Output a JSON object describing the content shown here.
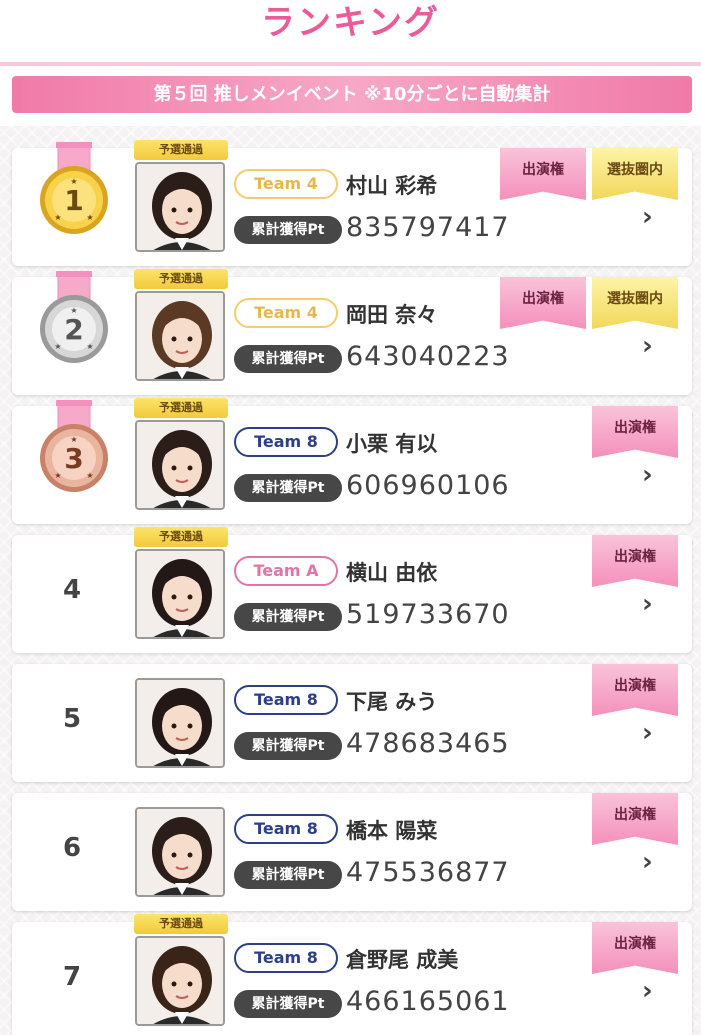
{
  "header": {
    "title": "ランキング"
  },
  "banner": {
    "text": "第５回 推しメンイベント ※10分ごとに自動集計"
  },
  "pt_label": "累計獲得Pt",
  "qual_label": "予選通過",
  "colors": {
    "accent_pink": "#ec5a97",
    "team8_navy": "#2e3f8a",
    "team4_gold": "#e6b84c",
    "teamA_pink": "#e374a8"
  },
  "rankings": [
    {
      "rank": "1",
      "medal": "gold",
      "qualified": true,
      "team": "Team 4",
      "team_class": "t4",
      "name": "村山 彩希",
      "points": "835797417",
      "tags": [
        "出演権",
        "選抜圏内"
      ]
    },
    {
      "rank": "2",
      "medal": "silver",
      "qualified": true,
      "team": "Team 4",
      "team_class": "t4",
      "name": "岡田 奈々",
      "points": "643040223",
      "tags": [
        "出演権",
        "選抜圏内"
      ]
    },
    {
      "rank": "3",
      "medal": "bronze",
      "qualified": true,
      "team": "Team 8",
      "team_class": "t8",
      "name": "小栗 有以",
      "points": "606960106",
      "tags": [
        "出演権"
      ]
    },
    {
      "rank": "4",
      "medal": "",
      "qualified": true,
      "team": "Team A",
      "team_class": "tA",
      "name": "横山 由依",
      "points": "519733670",
      "tags": [
        "出演権"
      ]
    },
    {
      "rank": "5",
      "medal": "",
      "qualified": false,
      "team": "Team 8",
      "team_class": "t8",
      "name": "下尾 みう",
      "points": "478683465",
      "tags": [
        "出演権"
      ]
    },
    {
      "rank": "6",
      "medal": "",
      "qualified": false,
      "team": "Team 8",
      "team_class": "t8",
      "name": "橋本 陽菜",
      "points": "475536877",
      "tags": [
        "出演権"
      ]
    },
    {
      "rank": "7",
      "medal": "",
      "qualified": true,
      "team": "Team 8",
      "team_class": "t8",
      "name": "倉野尾 成美",
      "points": "466165061",
      "tags": [
        "出演権"
      ]
    }
  ]
}
